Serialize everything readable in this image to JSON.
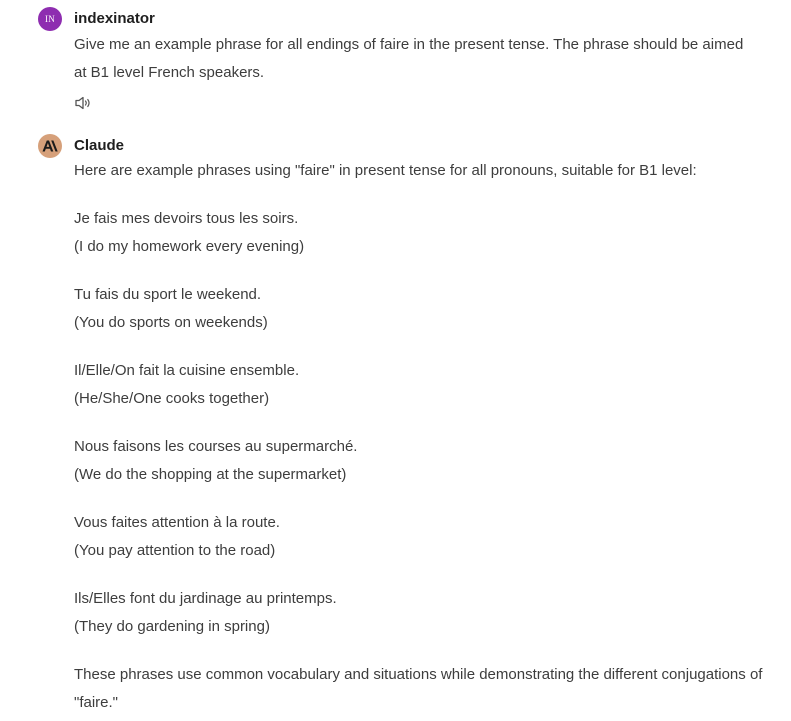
{
  "messages": [
    {
      "author": "indexinator",
      "avatar_initials": "IN",
      "avatar_color": "#8e2db0",
      "text": "Give me an example phrase for all endings of faire in the present tense. The phrase should be aimed at B1 level French speakers.",
      "actions": [
        {
          "icon": "speaker-icon"
        }
      ]
    },
    {
      "author": "Claude",
      "avatar_icon": "claude-logo-icon",
      "avatar_color": "#d6a07a",
      "paragraphs": [
        "Here are example phrases using \"faire\" in present tense for all pronouns, suitable for B1 level:",
        "Je fais mes devoirs tous les soirs.\n(I do my homework every evening)",
        "Tu fais du sport le weekend.\n(You do sports on weekends)",
        "Il/Elle/On fait la cuisine ensemble.\n(He/She/One cooks together)",
        "Nous faisons les courses au supermarché.\n(We do the shopping at the supermarket)",
        "Vous faites attention à la route.\n(You pay attention to the road)",
        "Ils/Elles font du jardinage au printemps.\n(They do gardening in spring)",
        "These phrases use common vocabulary and situations while demonstrating the different conjugations of \"faire.\""
      ]
    }
  ]
}
